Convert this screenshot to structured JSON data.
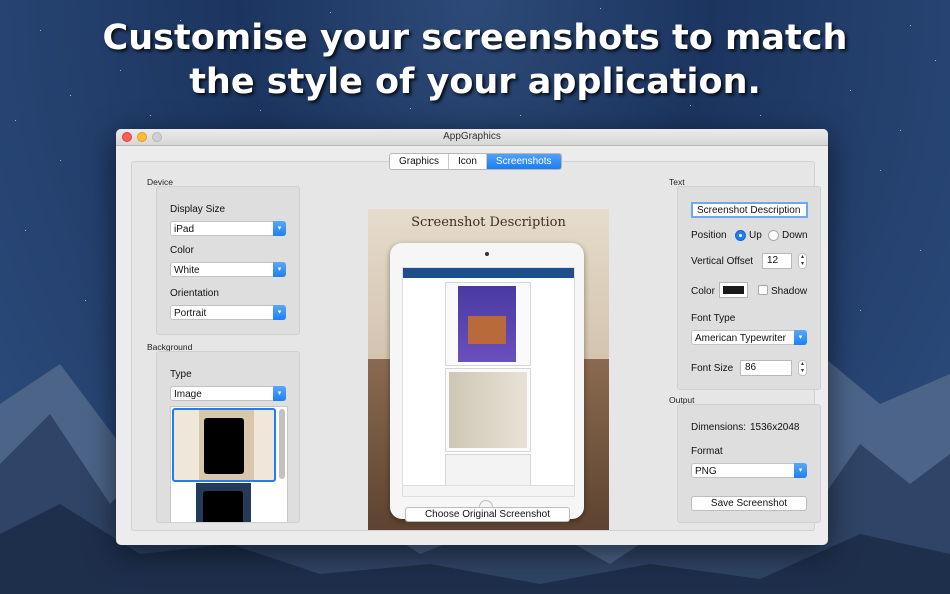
{
  "headline": {
    "line1": "Customise your screenshots to match",
    "line2": "the style of your application."
  },
  "window": {
    "title": "AppGraphics"
  },
  "tabs": [
    {
      "label": "Graphics",
      "active": false
    },
    {
      "label": "Icon",
      "active": false
    },
    {
      "label": "Screenshots",
      "active": true
    }
  ],
  "device": {
    "section": "Device",
    "display_size_label": "Display Size",
    "display_size_value": "iPad",
    "color_label": "Color",
    "color_value": "White",
    "orientation_label": "Orientation",
    "orientation_value": "Portrait"
  },
  "background": {
    "section": "Background",
    "type_label": "Type",
    "type_value": "Image"
  },
  "preview": {
    "title": "Screenshot Description",
    "choose_button": "Choose Original Screenshot"
  },
  "text": {
    "section": "Text",
    "description_value": "Screenshot Description",
    "position_label": "Position",
    "position_up": "Up",
    "position_down": "Down",
    "vertical_offset_label": "Vertical Offset",
    "vertical_offset_value": "12",
    "color_label": "Color",
    "shadow_label": "Shadow",
    "font_type_label": "Font Type",
    "font_type_value": "American Typewriter",
    "font_size_label": "Font Size",
    "font_size_value": "86",
    "swatch_color": "#1a1a1a"
  },
  "output": {
    "section": "Output",
    "dimensions_label": "Dimensions:",
    "dimensions_value": "1536x2048",
    "format_label": "Format",
    "format_value": "PNG",
    "save_button": "Save Screenshot"
  },
  "colors": {
    "accent": "#1f7ff2",
    "close": "#fc5f57",
    "minimize": "#fdbc2e"
  }
}
